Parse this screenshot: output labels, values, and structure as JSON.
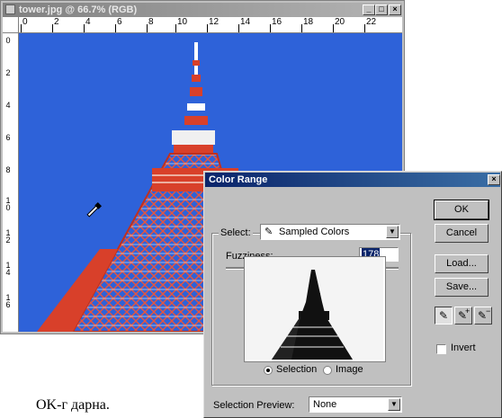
{
  "document": {
    "title": "tower.jpg @ 66.7% (RGB)",
    "window_buttons": [
      "_",
      "□",
      "×"
    ],
    "ruler_h": [
      "0",
      "2",
      "4",
      "6",
      "8",
      "10",
      "12",
      "14",
      "16",
      "18",
      "20",
      "22"
    ],
    "ruler_v": [
      "0",
      "2",
      "4",
      "6",
      "8",
      "10",
      "12",
      "14",
      "16"
    ],
    "sky_color": "#2e62d9",
    "tower_color": "#d8402a"
  },
  "dialog": {
    "title": "Color Range",
    "close": "×",
    "select_label": "Select:",
    "select_value": "Sampled Colors",
    "fuzziness_label": "Fuzziness:",
    "fuzziness_value": "178",
    "fuzziness_fraction": 0.89,
    "preview_selection_label": "Selection",
    "preview_image_label": "Image",
    "preview_mode": "Selection",
    "selection_preview_label": "Selection Preview:",
    "selection_preview_value": "None",
    "buttons": {
      "ok": "OK",
      "cancel": "Cancel",
      "load": "Load...",
      "save": "Save..."
    },
    "invert_label": "Invert",
    "invert_checked": false,
    "eyedroppers": [
      "eyedropper-icon",
      "eyedropper-plus-icon",
      "eyedropper-minus-icon"
    ]
  },
  "caption": "OK-г дарна."
}
